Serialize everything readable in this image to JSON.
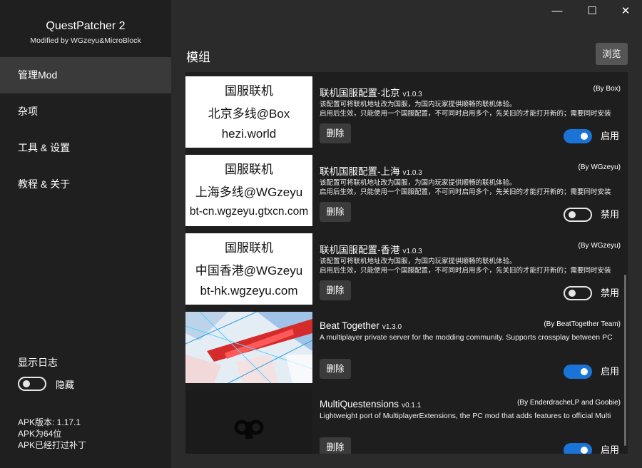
{
  "app": {
    "title": "QuestPatcher 2",
    "subtitle": "Modified by WGzeyu&MicroBlock"
  },
  "nav": {
    "items": [
      {
        "label": "管理Mod",
        "active": true
      },
      {
        "label": "杂项",
        "active": false
      },
      {
        "label": "工具 & 设置",
        "active": false
      },
      {
        "label": "教程 & 关于",
        "active": false
      }
    ]
  },
  "log": {
    "title": "显示日志",
    "state_label": "隐藏",
    "enabled": false
  },
  "apk": {
    "version": "APK版本: 1.17.1",
    "arch": "APK为64位",
    "patched": "APK已经打过补丁"
  },
  "window": {
    "minimize": "—",
    "maximize": "☐",
    "close": "✕"
  },
  "main": {
    "title": "模组",
    "browse_label": "浏览"
  },
  "mods": [
    {
      "name": "联机国服配置-北京",
      "version": "v1.0.3",
      "author": "(By Box)",
      "desc1": "该配置可将联机地址改为国服，为国内玩家提供顺畅的联机体验。",
      "desc2": "启用后生效，只能使用一个国服配置，不可同时启用多个，先关旧的才能打开新的；需要同时安装",
      "delete_label": "删除",
      "state_label": "启用",
      "enabled": true,
      "thumb": {
        "type": "text",
        "l1": "国服联机",
        "l2": "北京多线@Box",
        "l3": "hezi.world"
      }
    },
    {
      "name": "联机国服配置-上海",
      "version": "v1.0.3",
      "author": "(By WGzeyu)",
      "desc1": "该配置可将联机地址改为国服，为国内玩家提供顺畅的联机体验。",
      "desc2": "启用后生效，只能使用一个国服配置，不可同时启用多个，先关旧的才能打开新的；需要同时安装",
      "delete_label": "删除",
      "state_label": "禁用",
      "enabled": false,
      "thumb": {
        "type": "text",
        "l1": "国服联机",
        "l2": "上海多线@WGzeyu",
        "l3": "bt-cn.wgzeyu.gtxcn.com"
      }
    },
    {
      "name": "联机国服配置-香港",
      "version": "v1.0.3",
      "author": "(By WGzeyu)",
      "desc1": "该配置可将联机地址改为国服，为国内玩家提供顺畅的联机体验。",
      "desc2": "启用后生效，只能使用一个国服配置，不可同时启用多个，先关旧的才能打开新的；需要同时安装",
      "delete_label": "删除",
      "state_label": "禁用",
      "enabled": false,
      "thumb": {
        "type": "text",
        "l1": "国服联机",
        "l2": "中国香港@WGzeyu",
        "l3": "bt-hk.wgzeyu.com"
      }
    },
    {
      "name": "Beat Together",
      "version": "v1.3.0",
      "author": "(By BeatTogether Team)",
      "desc1": "A multiplayer private server for the modding community. Supports crossplay between PC",
      "desc2": "",
      "delete_label": "删除",
      "state_label": "启用",
      "enabled": true,
      "thumb": {
        "type": "art"
      }
    },
    {
      "name": "MultiQuestensions",
      "version": "v0.1.1",
      "author": "(By EnderdracheLP and Goobie)",
      "desc1": "Lightweight port of MultiplayerExtensions, the PC mod that adds features to official Multi",
      "desc2": "",
      "delete_label": "删除",
      "state_label": "启用",
      "enabled": true,
      "thumb": {
        "type": "logo"
      }
    }
  ],
  "colors": {
    "accent": "#1a74d6",
    "sidebar": "#1f1f1f",
    "background": "#2b2b2b",
    "list": "#1e1e1e"
  }
}
